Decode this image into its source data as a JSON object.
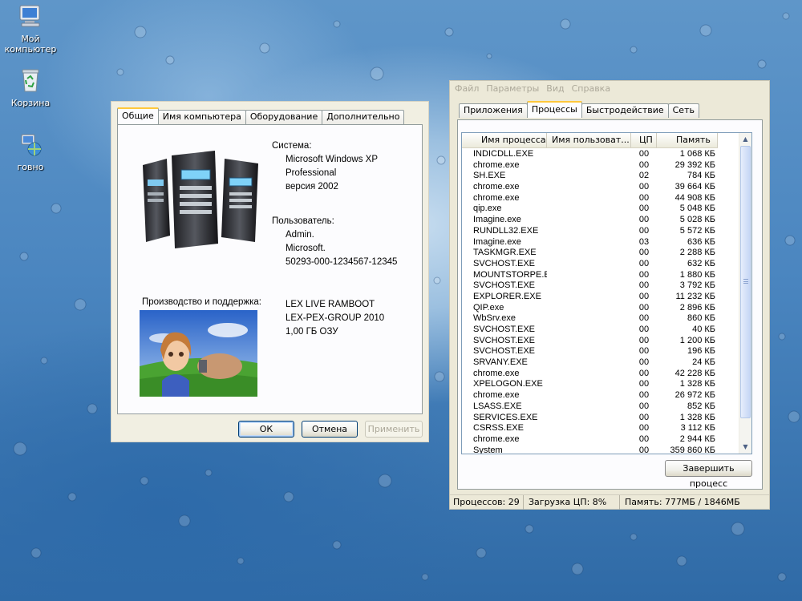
{
  "desktop": {
    "icons": [
      {
        "label": "Мой компьютер",
        "icon": "my-computer-icon"
      },
      {
        "label": "Корзина",
        "icon": "recycle-bin-icon"
      },
      {
        "label": "говно",
        "icon": "network-folder-icon"
      }
    ]
  },
  "system_properties": {
    "tabs": [
      "Общие",
      "Имя компьютера",
      "Оборудование",
      "Дополнительно"
    ],
    "active_tab": "Общие",
    "system_label": "Система:",
    "system_lines": [
      "Microsoft Windows XP",
      "Professional",
      "версия 2002"
    ],
    "user_label": "Пользователь:",
    "user_lines": [
      "Admin.",
      "Microsoft.",
      "50293-000-1234567-12345"
    ],
    "support_label": "Производство и поддержка:",
    "support_lines": [
      "LEX LIVE RAMBOOT",
      "LEX-PEX-GROUP 2010",
      "1,00 ГБ ОЗУ"
    ],
    "buttons": {
      "ok": "ОК",
      "cancel": "Отмена",
      "apply": "Применить"
    }
  },
  "task_manager": {
    "menu": [
      "Файл",
      "Параметры",
      "Вид",
      "Справка"
    ],
    "tabs": [
      "Приложения",
      "Процессы",
      "Быстродействие",
      "Сеть"
    ],
    "active_tab": "Процессы",
    "columns": [
      "Имя процесса",
      "Имя пользоват...",
      "ЦП",
      "Память"
    ],
    "processes": [
      {
        "name": "INDICDLL.EXE",
        "user": "",
        "cpu": "00",
        "mem": "1 068 КБ"
      },
      {
        "name": "chrome.exe",
        "user": "",
        "cpu": "00",
        "mem": "29 392 КБ"
      },
      {
        "name": "SH.EXE",
        "user": "",
        "cpu": "02",
        "mem": "784 КБ"
      },
      {
        "name": "chrome.exe",
        "user": "",
        "cpu": "00",
        "mem": "39 664 КБ"
      },
      {
        "name": "chrome.exe",
        "user": "",
        "cpu": "00",
        "mem": "44 908 КБ"
      },
      {
        "name": "qip.exe",
        "user": "",
        "cpu": "00",
        "mem": "5 048 КБ"
      },
      {
        "name": "Imagine.exe",
        "user": "",
        "cpu": "00",
        "mem": "5 028 КБ"
      },
      {
        "name": "RUNDLL32.EXE",
        "user": "",
        "cpu": "00",
        "mem": "5 572 КБ"
      },
      {
        "name": "Imagine.exe",
        "user": "",
        "cpu": "03",
        "mem": "636 КБ"
      },
      {
        "name": "TASKMGR.EXE",
        "user": "",
        "cpu": "00",
        "mem": "2 288 КБ"
      },
      {
        "name": "SVCHOST.EXE",
        "user": "",
        "cpu": "00",
        "mem": "632 КБ"
      },
      {
        "name": "MOUNTSTORPE.EXE",
        "user": "",
        "cpu": "00",
        "mem": "1 880 КБ"
      },
      {
        "name": "SVCHOST.EXE",
        "user": "",
        "cpu": "00",
        "mem": "3 792 КБ"
      },
      {
        "name": "EXPLORER.EXE",
        "user": "",
        "cpu": "00",
        "mem": "11 232 КБ"
      },
      {
        "name": "QIP.exe",
        "user": "",
        "cpu": "00",
        "mem": "2 896 КБ"
      },
      {
        "name": "WbSrv.exe",
        "user": "",
        "cpu": "00",
        "mem": "860 КБ"
      },
      {
        "name": "SVCHOST.EXE",
        "user": "",
        "cpu": "00",
        "mem": "40 КБ"
      },
      {
        "name": "SVCHOST.EXE",
        "user": "",
        "cpu": "00",
        "mem": "1 200 КБ"
      },
      {
        "name": "SVCHOST.EXE",
        "user": "",
        "cpu": "00",
        "mem": "196 КБ"
      },
      {
        "name": "SRVANY.EXE",
        "user": "",
        "cpu": "00",
        "mem": "24 КБ"
      },
      {
        "name": "chrome.exe",
        "user": "",
        "cpu": "00",
        "mem": "42 228 КБ"
      },
      {
        "name": "XPELOGON.EXE",
        "user": "",
        "cpu": "00",
        "mem": "1 328 КБ"
      },
      {
        "name": "chrome.exe",
        "user": "",
        "cpu": "00",
        "mem": "26 972 КБ"
      },
      {
        "name": "LSASS.EXE",
        "user": "",
        "cpu": "00",
        "mem": "852 КБ"
      },
      {
        "name": "SERVICES.EXE",
        "user": "",
        "cpu": "00",
        "mem": "1 328 КБ"
      },
      {
        "name": "CSRSS.EXE",
        "user": "",
        "cpu": "00",
        "mem": "3 112 КБ"
      },
      {
        "name": "chrome.exe",
        "user": "",
        "cpu": "00",
        "mem": "2 944 КБ"
      },
      {
        "name": "System",
        "user": "",
        "cpu": "00",
        "mem": "359 860 КБ"
      }
    ],
    "end_process_button": "Завершить процесс",
    "status": {
      "processes": "Процессов: 29",
      "cpu": "Загрузка ЦП: 8%",
      "memory": "Память: 777МБ / 1846МБ"
    }
  }
}
